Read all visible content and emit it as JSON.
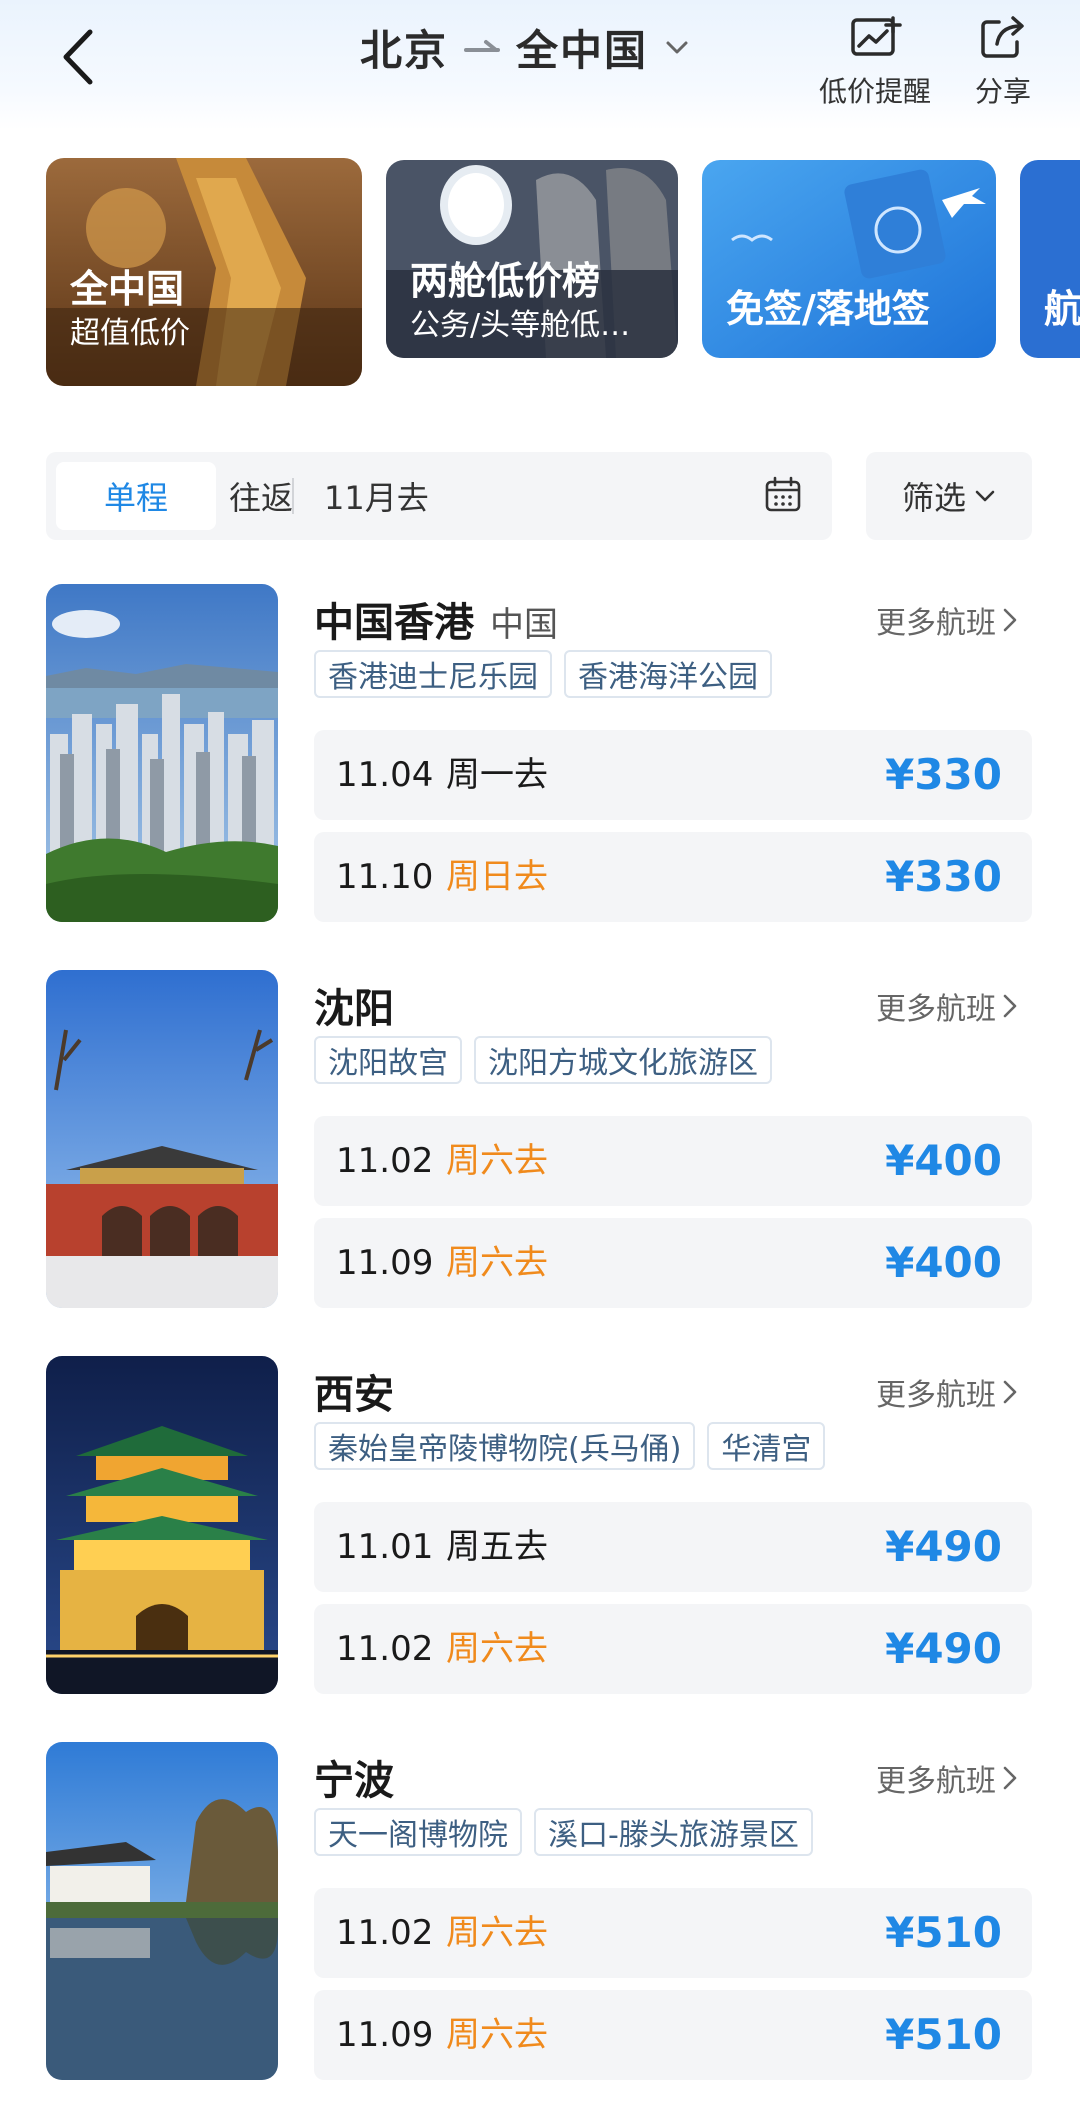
{
  "header": {
    "origin": "北京",
    "destination": "全中国",
    "actions": [
      {
        "label": "低价提醒",
        "icon": "price-alert-icon"
      },
      {
        "label": "分享",
        "icon": "share-icon"
      }
    ]
  },
  "categories": [
    {
      "title": "全中国",
      "subtitle": "超值低价"
    },
    {
      "title": "两舱低价榜",
      "subtitle": "公务/头等舱低…"
    },
    {
      "title": "免签/落地签",
      "subtitle": ""
    },
    {
      "title": "航",
      "subtitle": ""
    }
  ],
  "filters": {
    "one_way": "单程",
    "round_trip": "往返",
    "month": "11月去",
    "filter_label": "筛选"
  },
  "colors": {
    "accent_blue": "#1f88e5",
    "weekend_orange": "#f08a1c"
  },
  "destinations": [
    {
      "name": "中国香港",
      "region": "中国",
      "more": "更多航班",
      "photo": "hong-kong-skyline-photo",
      "tags": [
        "香港迪士尼乐园",
        "香港海洋公园"
      ],
      "fares": [
        {
          "date": "11.04",
          "day": "周一去",
          "weekend": false,
          "price": "¥330"
        },
        {
          "date": "11.10",
          "day": "周日去",
          "weekend": true,
          "price": "¥330"
        }
      ]
    },
    {
      "name": "沈阳",
      "region": "",
      "more": "更多航班",
      "photo": "shenyang-palace-gate-photo",
      "tags": [
        "沈阳故宫",
        "沈阳方城文化旅游区"
      ],
      "fares": [
        {
          "date": "11.02",
          "day": "周六去",
          "weekend": true,
          "price": "¥400"
        },
        {
          "date": "11.09",
          "day": "周六去",
          "weekend": true,
          "price": "¥400"
        }
      ]
    },
    {
      "name": "西安",
      "region": "",
      "more": "更多航班",
      "photo": "xian-bell-tower-photo",
      "tags": [
        "秦始皇帝陵博物院(兵马俑)",
        "华清宫"
      ],
      "fares": [
        {
          "date": "11.01",
          "day": "周五去",
          "weekend": false,
          "price": "¥490"
        },
        {
          "date": "11.02",
          "day": "周六去",
          "weekend": true,
          "price": "¥490"
        }
      ]
    },
    {
      "name": "宁波",
      "region": "",
      "more": "更多航班",
      "photo": "ningbo-tianyi-pavilion-photo",
      "tags": [
        "天一阁博物院",
        "溪口-滕头旅游景区"
      ],
      "fares": [
        {
          "date": "11.02",
          "day": "周六去",
          "weekend": true,
          "price": "¥510"
        },
        {
          "date": "11.09",
          "day": "周六去",
          "weekend": true,
          "price": "¥510"
        }
      ]
    }
  ]
}
